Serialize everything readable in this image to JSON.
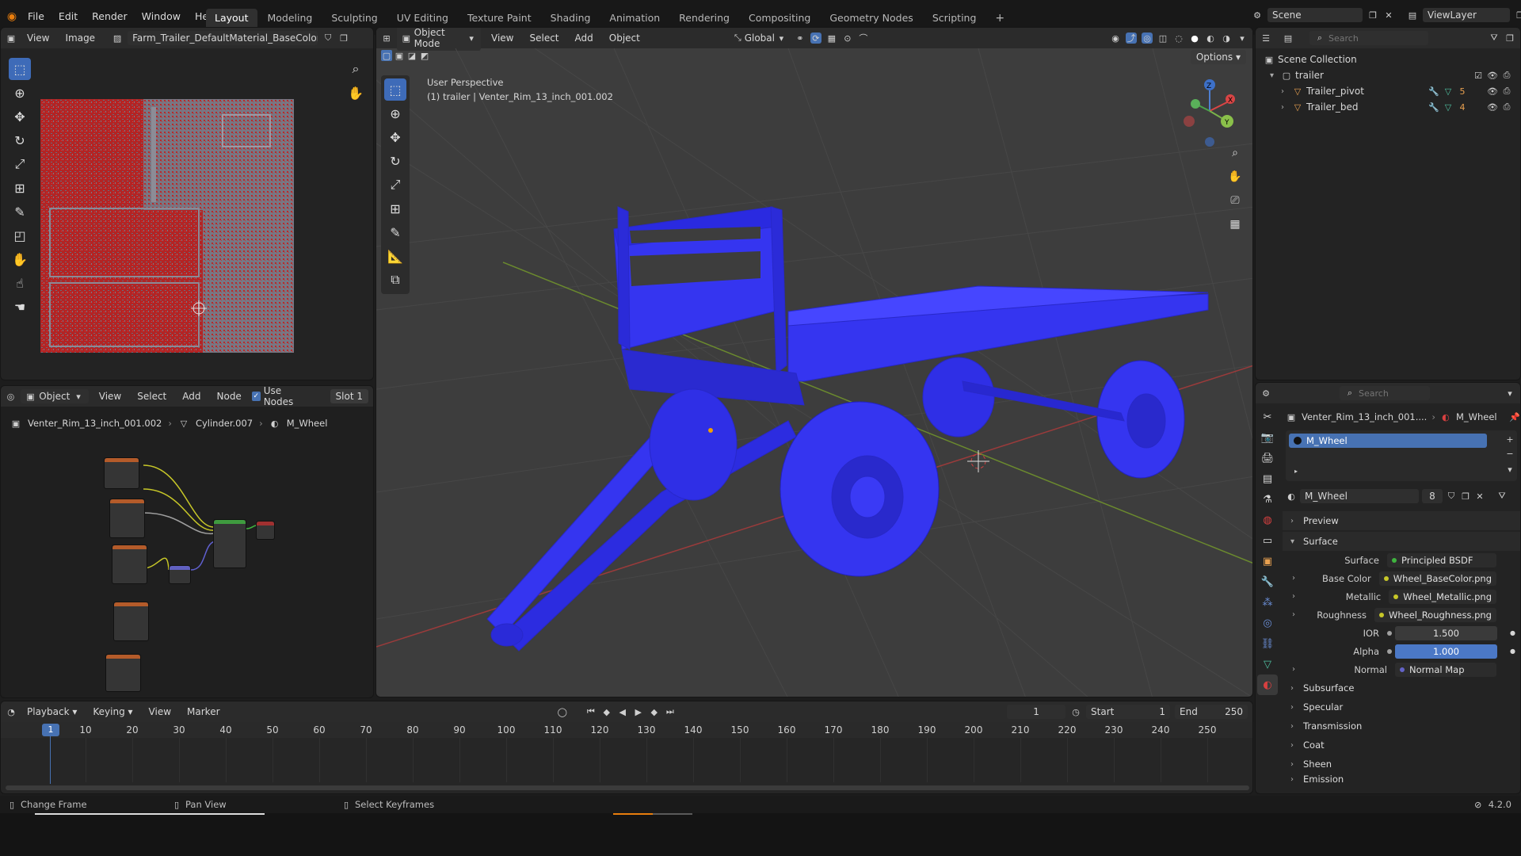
{
  "menu": [
    "File",
    "Edit",
    "Render",
    "Window",
    "Help"
  ],
  "workspace_tabs": [
    "Layout",
    "Modeling",
    "Sculpting",
    "UV Editing",
    "Texture Paint",
    "Shading",
    "Animation",
    "Rendering",
    "Compositing",
    "Geometry Nodes",
    "Scripting"
  ],
  "active_tab": "Layout",
  "scene_name": "Scene",
  "view_layer": "ViewLayer",
  "image_editor": {
    "view": "View",
    "image_menu": "Image",
    "image_name": "Farm_Trailer_DefaultMaterial_BaseColor.png"
  },
  "node_editor": {
    "mode": "Object",
    "menus": [
      "View",
      "Select",
      "Add",
      "Node"
    ],
    "use_nodes": "Use Nodes",
    "slot": "Slot 1",
    "breadcrumb": [
      "Venter_Rim_13_inch_001.002",
      "Cylinder.007",
      "M_Wheel"
    ]
  },
  "viewport": {
    "mode": "Object Mode",
    "menus": [
      "View",
      "Select",
      "Add",
      "Object"
    ],
    "orientation": "Global",
    "options": "Options",
    "perspective": "User Perspective",
    "object_info": "(1) trailer | Venter_Rim_13_inch_001.002",
    "gizmo": {
      "x": "X",
      "y": "Y",
      "z": "Z"
    }
  },
  "outliner": {
    "search_placeholder": "Search",
    "scene_collection": "Scene Collection",
    "collection": "trailer",
    "items": [
      "Trailer_pivot",
      "Trailer_bed"
    ],
    "badge_counts": [
      "5",
      "4"
    ]
  },
  "properties": {
    "search_placeholder": "Search",
    "breadcrumb_object": "Venter_Rim_13_inch_001....",
    "breadcrumb_material": "M_Wheel",
    "slot_material": "M_Wheel",
    "material_name": "M_Wheel",
    "user_count": "8",
    "preview": "Preview",
    "surface_section": "Surface",
    "surface_label": "Surface",
    "surface_value": "Principled BSDF",
    "rows": [
      {
        "label": "Base Color",
        "value": "Wheel_BaseColor.png"
      },
      {
        "label": "Metallic",
        "value": "Wheel_Metallic.png"
      },
      {
        "label": "Roughness",
        "value": "Wheel_Roughness.png"
      }
    ],
    "ior_label": "IOR",
    "ior_value": "1.500",
    "alpha_label": "Alpha",
    "alpha_value": "1.000",
    "normal_label": "Normal",
    "normal_value": "Normal Map",
    "subsections": [
      "Subsurface",
      "Specular",
      "Transmission",
      "Coat",
      "Sheen",
      "Emission"
    ]
  },
  "timeline": {
    "menus": [
      "Playback",
      "Keying",
      "View",
      "Marker"
    ],
    "current_frame": "1",
    "start_label": "Start",
    "start": "1",
    "end_label": "End",
    "end": "250",
    "ticks": [
      "1",
      "10",
      "20",
      "30",
      "40",
      "50",
      "60",
      "70",
      "80",
      "90",
      "100",
      "110",
      "120",
      "130",
      "140",
      "150",
      "160",
      "170",
      "180",
      "190",
      "200",
      "210",
      "220",
      "230",
      "240",
      "250"
    ]
  },
  "statusbar": {
    "change_frame": "Change Frame",
    "pan_view": "Pan View",
    "select_keyframes": "Select Keyframes",
    "version": "4.2.0"
  },
  "colors": {
    "accent": "#4772b3",
    "mesh": "#3535f0",
    "texture_red": "#c42a2a"
  }
}
